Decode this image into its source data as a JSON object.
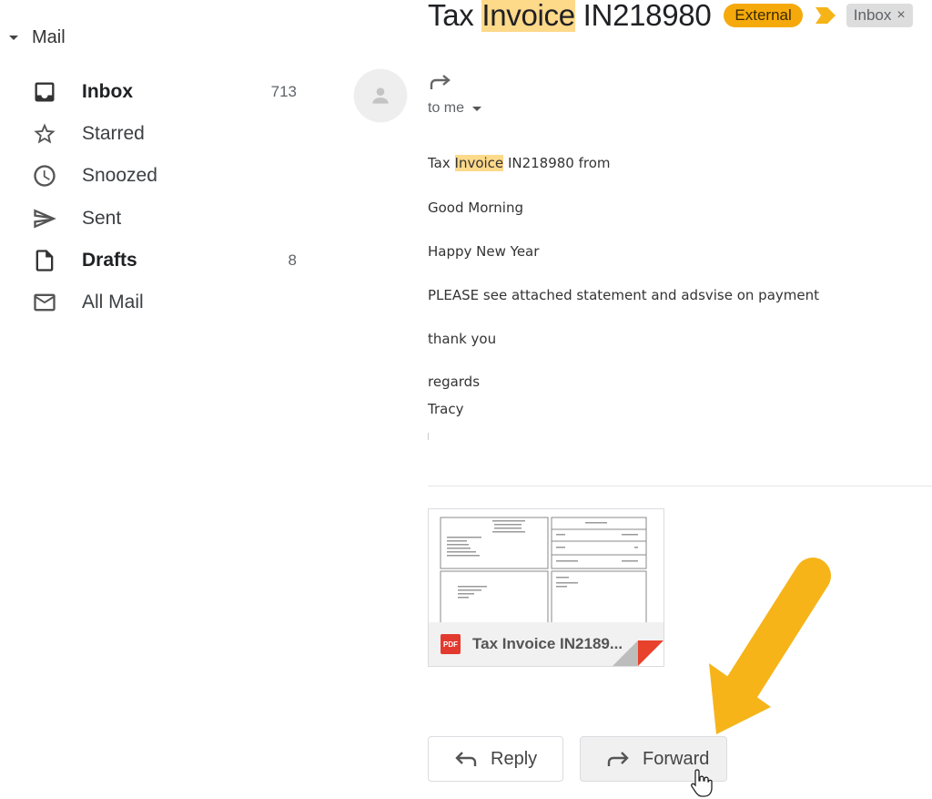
{
  "sidebar": {
    "section_title": "Mail",
    "items": [
      {
        "label": "Inbox",
        "count": "713",
        "icon": "inbox-icon",
        "bold": true
      },
      {
        "label": "Starred",
        "count": "",
        "icon": "star-icon",
        "bold": false
      },
      {
        "label": "Snoozed",
        "count": "",
        "icon": "clock-icon",
        "bold": false
      },
      {
        "label": "Sent",
        "count": "",
        "icon": "send-icon",
        "bold": false
      },
      {
        "label": "Drafts",
        "count": "8",
        "icon": "draft-icon",
        "bold": true
      },
      {
        "label": "All Mail",
        "count": "",
        "icon": "mail-icon",
        "bold": false
      }
    ]
  },
  "email": {
    "subject_prefix": "Tax ",
    "subject_highlight": "Invoice",
    "subject_suffix": " IN218980",
    "labels": {
      "external": "External",
      "inbox": "Inbox",
      "inbox_close": "×"
    },
    "recipient": "to me",
    "body": {
      "line1_prefix": "Tax ",
      "line1_highlight": "Invoice",
      "line1_suffix": " IN218980 from",
      "greeting": "Good Morning",
      "wishes": "Happy New Year",
      "request": "PLEASE see attached statement and adsvise on payment",
      "thanks": "thank you",
      "signoff": "regards",
      "signature": "Tracy"
    },
    "attachment": {
      "type_label": "PDF",
      "name": "Tax Invoice IN2189..."
    }
  },
  "actions": {
    "reply_label": "Reply",
    "forward_label": "Forward"
  },
  "colors": {
    "highlight": "#fdd98a",
    "external_badge": "#f5a90b",
    "annotation_arrow": "#f6b419",
    "pdf_red": "#e23a2f"
  }
}
